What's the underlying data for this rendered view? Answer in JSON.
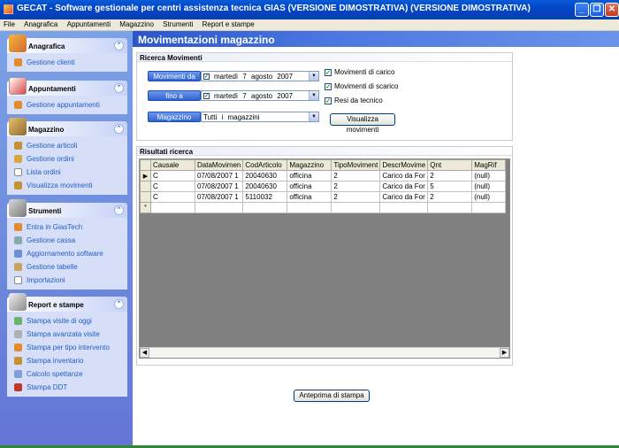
{
  "window": {
    "title": "GECAT - Software gestionale per centri assistenza tecnica GIAS (VERSIONE DIMOSTRATIVA)  (VERSIONE DIMOSTRATIVA)",
    "min": "_",
    "max": "❐",
    "close": "✕"
  },
  "menu": [
    "File",
    "Anagrafica",
    "Appuntamenti",
    "Magazzino",
    "Strumenti",
    "Report e stampe"
  ],
  "sidebar": {
    "groups": [
      {
        "title": "Anagrafica",
        "items": [
          "Gestione clienti"
        ]
      },
      {
        "title": "Appuntamenti",
        "items": [
          "Gestione appuntamenti"
        ]
      },
      {
        "title": "Magazzino",
        "items": [
          "Gestione articoli",
          "Gestione ordini",
          "Lista ordini",
          "Visualizza movimenti"
        ]
      },
      {
        "title": "Strumenti",
        "items": [
          "Entra in GiasTech",
          "Gestione cassa",
          "Aggiornamento software",
          "Gestione tabelle",
          "Importazioni"
        ]
      },
      {
        "title": "Report e stampe",
        "items": [
          "Stampa visite di oggi",
          "Stampa avanzata visite",
          "Stampa per tipo intervento",
          "Stampa inventario",
          "Calcolo spettanze",
          "Stampa DDT"
        ]
      }
    ]
  },
  "main": {
    "title": "Movimentazioni magazzino",
    "search": {
      "title": "Ricerca Movimenti",
      "from_label": "Movimenti da",
      "from_date": "martedì   7   agosto   2007",
      "to_label": "fino a",
      "to_date": "martedì   7   agosto   2007",
      "warehouse_label": "Magazzino",
      "warehouse_value": "Tutti i magazzini",
      "check_carico": "Movimenti di carico",
      "check_scarico": "Movimenti di scarico",
      "check_resi": "Resi da tecnico",
      "show_button": "Visualizza movimenti"
    },
    "results": {
      "title": "Risultati ricerca",
      "columns": [
        "Causale",
        "DataMovimen",
        "CodArticolo",
        "Magazzino",
        "TipoMoviment",
        "DescrMovime",
        "Qnt",
        "MagRif"
      ],
      "rows": [
        [
          "C",
          "07/08/2007 1",
          "20040630",
          "officina",
          "2",
          "Carico da For",
          "2",
          "(null)"
        ],
        [
          "C",
          "07/08/2007 1",
          "20040630",
          "officina",
          "2",
          "Carico da For",
          "5",
          "(null)"
        ],
        [
          "C",
          "07/08/2007 1",
          "5110032",
          "officina",
          "2",
          "Carico da For",
          "2",
          "(null)"
        ]
      ],
      "current_marker": "▶",
      "new_marker": "*"
    },
    "print_preview_button": "Anteprima di stampa"
  }
}
